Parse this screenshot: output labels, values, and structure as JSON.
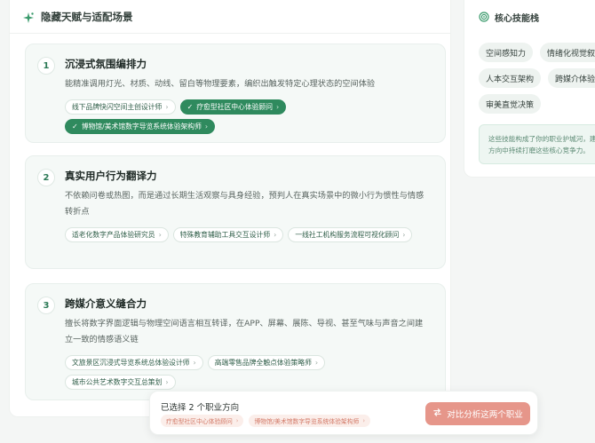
{
  "left_panel": {
    "title": "隐藏天赋与适配场景",
    "icon": "sparkle-icon"
  },
  "cards": [
    {
      "num": "1",
      "title": "沉浸式氛围编排力",
      "desc": "能精准调用灯光、材质、动线、留白等物理要素，编织出触发特定心理状态的空间体验",
      "chips": [
        {
          "label": "线下品牌快闪空间主创设计师",
          "selected": false
        },
        {
          "label": "疗愈型社区中心体验顾问",
          "selected": true
        },
        {
          "label": "博物馆/美术馆数字导览系统体验架构师",
          "selected": true
        }
      ]
    },
    {
      "num": "2",
      "title": "真实用户行为翻译力",
      "desc": "不依赖问卷或热图，而是通过长期生活观察与具身经验，预判人在真实场景中的微小行为惯性与情感转折点",
      "chips": [
        {
          "label": "适老化数字产品体验研究员",
          "selected": false
        },
        {
          "label": "特殊教育辅助工具交互设计师",
          "selected": false
        },
        {
          "label": "一线社工机构服务流程可视化顾问",
          "selected": false
        }
      ]
    },
    {
      "num": "3",
      "title": "跨媒介意义缝合力",
      "desc": "擅长将数字界面逻辑与物理空间语言相互转译，在APP、屏幕、展陈、导视、甚至气味与声音之间建立一致的情感语义链",
      "chips": [
        {
          "label": "文旅景区沉浸式导览系统总体验设计师",
          "selected": false
        },
        {
          "label": "高端零售品牌全触点体验策略师",
          "selected": false
        },
        {
          "label": "城市公共艺术数字交互总策划",
          "selected": false
        }
      ]
    }
  ],
  "right_panel": {
    "title": "核心技能栈",
    "icon": "target-icon",
    "skills": [
      "空间感知力",
      "情绪化视觉叙事",
      "人本交互架构",
      "跨媒介体验设计",
      "审美直觉决策"
    ],
    "note": "这些技能构成了你的职业护城河，建议在新方向中持续打磨这些核心竞争力。"
  },
  "bottom_bar": {
    "label": "已选择 2 个职业方向",
    "selected": [
      "疗愈型社区中心体验顾问",
      "博物馆/美术馆数字导览系统体验架构师"
    ],
    "button_label": "对比分析这两个职业",
    "button_icon": "compare-icon"
  },
  "colors": {
    "accent": "#2f8a5e",
    "button": "#e6968a",
    "chip_selected_bg": "#fbeeea"
  }
}
